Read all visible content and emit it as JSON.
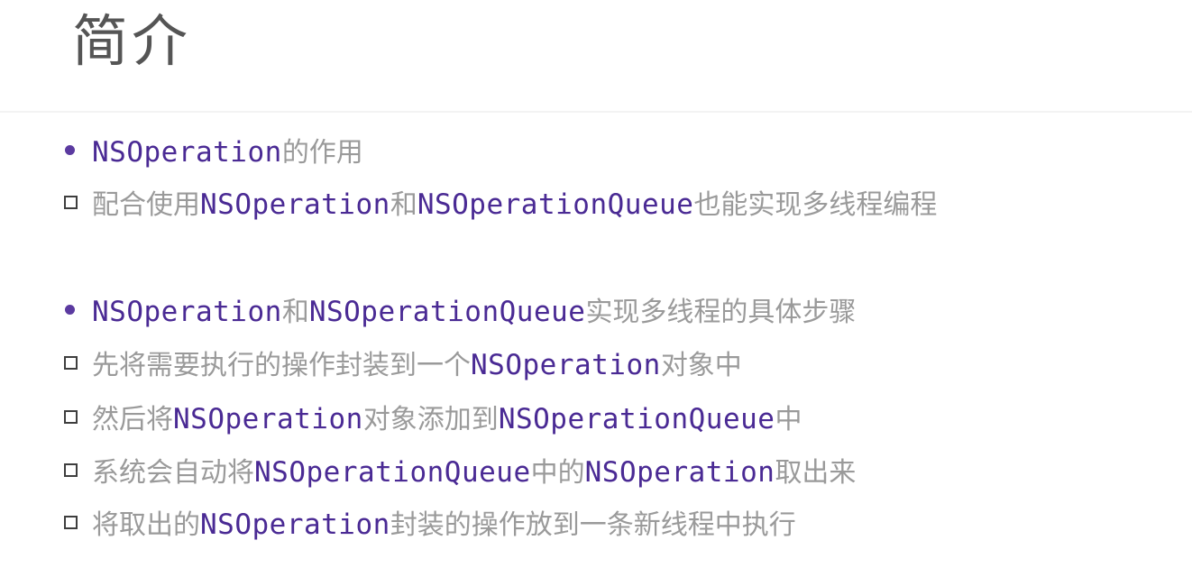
{
  "title": "简介",
  "lines": [
    {
      "bullet": "dot",
      "segments": [
        {
          "text": "NSOperation",
          "code": true
        },
        {
          "text": "的作用",
          "code": false
        }
      ]
    },
    {
      "bullet": "square",
      "segments": [
        {
          "text": "配合使用",
          "code": false
        },
        {
          "text": "NSOperation",
          "code": true
        },
        {
          "text": "和",
          "code": false
        },
        {
          "text": "NSOperationQueue",
          "code": true
        },
        {
          "text": "也能实现多线程编程",
          "code": false
        }
      ]
    },
    {
      "bullet": "dot",
      "segments": [
        {
          "text": "NSOperation",
          "code": true
        },
        {
          "text": "和",
          "code": false
        },
        {
          "text": "NSOperationQueue",
          "code": true
        },
        {
          "text": "实现多线程的具体步骤",
          "code": false
        }
      ]
    },
    {
      "bullet": "square",
      "segments": [
        {
          "text": "先将需要执行的操作封装到一个",
          "code": false
        },
        {
          "text": "NSOperation",
          "code": true
        },
        {
          "text": "对象中",
          "code": false
        }
      ]
    },
    {
      "bullet": "square",
      "segments": [
        {
          "text": "然后将",
          "code": false
        },
        {
          "text": "NSOperation",
          "code": true
        },
        {
          "text": "对象添加到",
          "code": false
        },
        {
          "text": "NSOperationQueue",
          "code": true
        },
        {
          "text": "中",
          "code": false
        }
      ]
    },
    {
      "bullet": "square",
      "segments": [
        {
          "text": "系统会自动将",
          "code": false
        },
        {
          "text": "NSOperationQueue",
          "code": true
        },
        {
          "text": "中的",
          "code": false
        },
        {
          "text": "NSOperation",
          "code": true
        },
        {
          "text": "取出来",
          "code": false
        }
      ]
    },
    {
      "bullet": "square",
      "segments": [
        {
          "text": "将取出的",
          "code": false
        },
        {
          "text": "NSOperation",
          "code": true
        },
        {
          "text": "封装的操作放到一条新线程中执行",
          "code": false
        }
      ]
    }
  ],
  "colors": {
    "code": "#4a2a94",
    "text": "#9a9a9a",
    "dot_bullet": "#5b3aa0",
    "square_bullet": "#3e3e3e",
    "title": "#555555"
  }
}
